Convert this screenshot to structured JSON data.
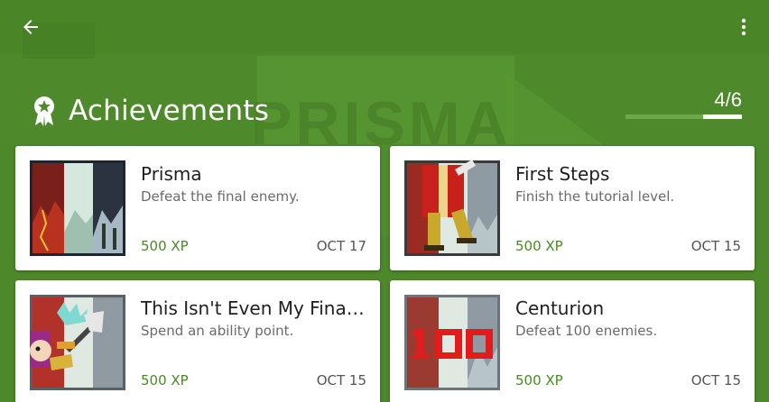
{
  "header": {
    "title": "Achievements",
    "back_icon": "arrow-left-icon",
    "menu_icon": "more-vert-icon",
    "title_icon": "award-ribbon-icon"
  },
  "background": {
    "watermark": "PRISMA"
  },
  "progress": {
    "label": "4/6",
    "unlocked": 4,
    "total": 6,
    "fraction": 0.6667
  },
  "colors": {
    "accent_green": "#4a8a24",
    "background_green": "#4f8a2c",
    "card_bg": "#ffffff"
  },
  "achievements": [
    {
      "name": "Prisma",
      "description": "Defeat the final enemy.",
      "xp": "500 XP",
      "date": "OCT 17",
      "icon": "prisma-art-icon"
    },
    {
      "name": "First Steps",
      "description": "Finish the tutorial level.",
      "xp": "500 XP",
      "date": "OCT 15",
      "icon": "marching-soldier-icon"
    },
    {
      "name": "This Isn't Even My Final Form",
      "description": "Spend an ability point.",
      "xp": "500 XP",
      "date": "OCT 15",
      "icon": "warrior-axe-icon"
    },
    {
      "name": "Centurion",
      "description": "Defeat 100 enemies.",
      "xp": "500 XP",
      "date": "OCT 15",
      "icon": "hundred-icon"
    }
  ]
}
